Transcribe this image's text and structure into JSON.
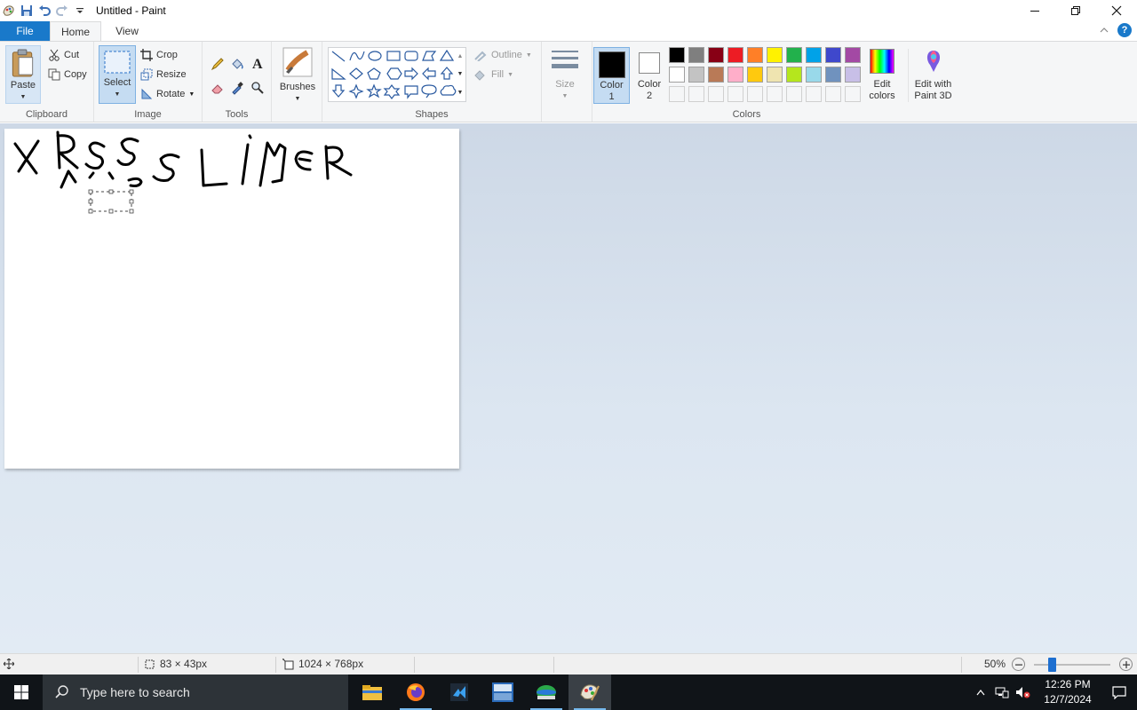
{
  "window": {
    "title": "Untitled - Paint"
  },
  "tabs": [
    "File",
    "Home",
    "View"
  ],
  "ribbon": {
    "clipboard": {
      "label": "Clipboard",
      "paste": "Paste",
      "cut": "Cut",
      "copy": "Copy"
    },
    "image": {
      "label": "Image",
      "select": "Select",
      "crop": "Crop",
      "resize": "Resize",
      "rotate": "Rotate"
    },
    "tools": {
      "label": "Tools"
    },
    "brushes": {
      "label": "Brushes"
    },
    "shapes": {
      "label": "Shapes",
      "outline": "Outline",
      "fill": "Fill"
    },
    "size": {
      "label": "Size"
    },
    "color1": {
      "line1": "Color",
      "line2": "1",
      "value": "#000000"
    },
    "color2": {
      "line1": "Color",
      "line2": "2",
      "value": "#ffffff"
    },
    "colors": {
      "label": "Colors",
      "row1": [
        "#000000",
        "#7f7f7f",
        "#880015",
        "#ed1c24",
        "#ff7f27",
        "#fff200",
        "#22b14c",
        "#00a2e8",
        "#3f48cc",
        "#a349a4"
      ],
      "row2": [
        "#ffffff",
        "#c3c3c3",
        "#b97a57",
        "#ffaec9",
        "#ffc90e",
        "#efe4b0",
        "#b5e61d",
        "#99d9ea",
        "#7092be",
        "#c8bfe7"
      ]
    },
    "edit_colors": {
      "line1": "Edit",
      "line2": "colors"
    },
    "paint3d": {
      "line1": "Edit with",
      "line2": "Paint 3D"
    }
  },
  "status": {
    "selection_size": "83 × 43px",
    "image_size": "1024 × 768px",
    "zoom": "50%"
  },
  "taskbar": {
    "search_placeholder": "Type here to search",
    "time": "12:26 PM",
    "date": "12/7/2024"
  }
}
